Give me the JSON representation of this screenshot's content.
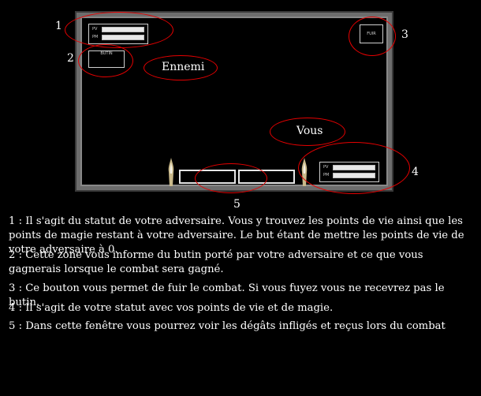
{
  "callouts": {
    "n1": "1",
    "n2": "2",
    "n3": "3",
    "n4": "4",
    "n5": "5"
  },
  "arena": {
    "enemy_label": "Ennemi",
    "you_label": "Vous",
    "pv_label": "PV",
    "pm_label": "PM",
    "loot_label": "BUTIN",
    "flee_label": "FUIR"
  },
  "descriptions": [
    "1 : Il s'agit du statut de votre adversaire. Vous y trouvez les points de vie ainsi que les points de magie restant à votre adversaire. Le but étant de mettre les points de vie de votre adversaire à 0.",
    "2 : Cette zone vous informe du butin porté par votre adversaire et ce que vous gagnerais lorsque le combat sera gagné.",
    "3 : Ce bouton vous permet de fuir le combat. Si vous fuyez vous ne recevrez pas le butin.",
    "4 : Il s'agit de votre statut avec vos points de vie et de magie.",
    "5 : Dans cette fenêtre vous pourrez voir les dégâts infligés et reçus lors du combat"
  ],
  "colors": {
    "annotation": "#e60000",
    "frame": "#6d6d6d",
    "panel_border": "#cfcfcf"
  }
}
